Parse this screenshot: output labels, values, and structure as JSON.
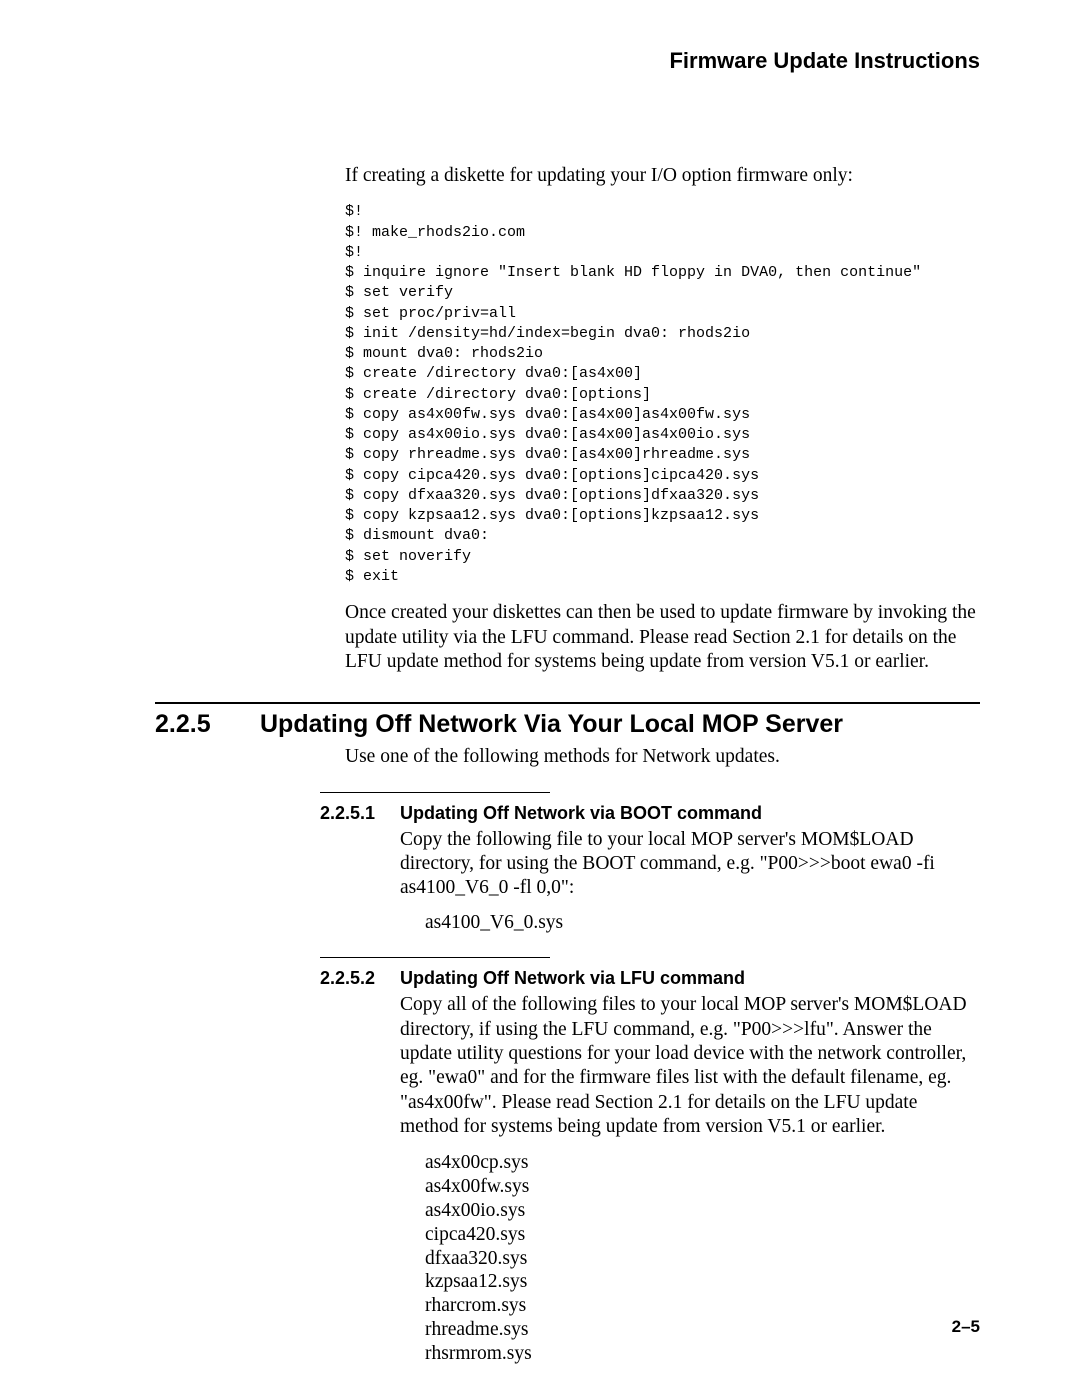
{
  "header": "Firmware Update Instructions",
  "intro_line": "If creating a diskette for updating your I/O option firmware only:",
  "code_block": "$!\n$! make_rhods2io.com\n$!\n$ inquire ignore \"Insert blank HD floppy in DVA0, then continue\"\n$ set verify\n$ set proc/priv=all\n$ init /density=hd/index=begin dva0: rhods2io\n$ mount dva0: rhods2io\n$ create /directory dva0:[as4x00]\n$ create /directory dva0:[options]\n$ copy as4x00fw.sys dva0:[as4x00]as4x00fw.sys\n$ copy as4x00io.sys dva0:[as4x00]as4x00io.sys\n$ copy rhreadme.sys dva0:[as4x00]rhreadme.sys\n$ copy cipca420.sys dva0:[options]cipca420.sys\n$ copy dfxaa320.sys dva0:[options]dfxaa320.sys\n$ copy kzpsaa12.sys dva0:[options]kzpsaa12.sys\n$ dismount dva0:\n$ set noverify\n$ exit",
  "after_code_para": "Once created your diskettes can then be used to update firmware by invoking the update utility via the LFU command. Please read Section 2.1 for details on the LFU update method for systems being update from version V5.1 or earlier.",
  "sec225": {
    "num": "2.2.5",
    "title": "Updating Off Network Via Your Local MOP Server",
    "intro": "Use one of the following methods for Network updates."
  },
  "sec2251": {
    "num": "2.2.5.1",
    "title": "Updating Off Network via BOOT command",
    "para": "Copy the following file to your local MOP server's MOM$LOAD directory, for using the BOOT command, e.g. \"P00>>>boot ewa0 -fi as4100_V6_0 -fl 0,0\":",
    "file": "as4100_V6_0.sys"
  },
  "sec2252": {
    "num": "2.2.5.2",
    "title": "Updating Off Network via LFU command",
    "para": "Copy all of the following files to your local MOP server's MOM$LOAD directory, if using the LFU command, e.g. \"P00>>>lfu\". Answer the update utility questions for your load device with the network controller, eg. \"ewa0\" and for the firmware files list with the default filename, eg. \"as4x00fw\". Please read Section 2.1 for details on the LFU update method for systems being update from version V5.1 or earlier.",
    "files": [
      "as4x00cp.sys",
      "as4x00fw.sys",
      "as4x00io.sys",
      "cipca420.sys",
      "dfxaa320.sys",
      "kzpsaa12.sys",
      "rharcrom.sys",
      "rhreadme.sys",
      "rhsrmrom.sys"
    ]
  },
  "page_number": "2–5"
}
